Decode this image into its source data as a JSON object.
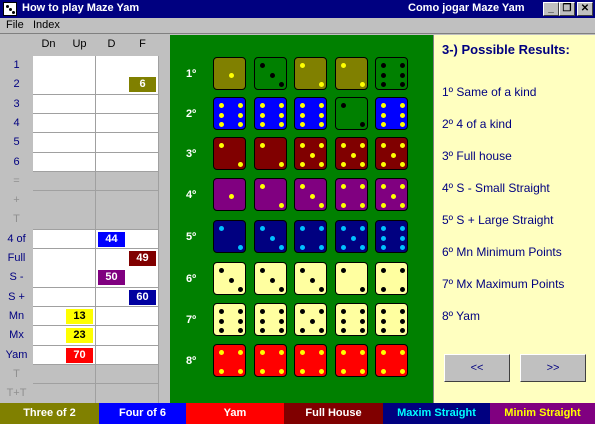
{
  "window": {
    "title_left": "How to play Maze Yam",
    "title_right": "Como jogar Maze Yam",
    "btn_minimize": "_",
    "btn_restore": "❐",
    "btn_close": "✕"
  },
  "menu": [
    "File",
    "Index"
  ],
  "sheet": {
    "columns": [
      "Dn",
      "Up",
      "D",
      "F"
    ],
    "rows": [
      "1",
      "2",
      "3",
      "4",
      "5",
      "6",
      "=",
      "+",
      "T",
      "4 of",
      "Full",
      "S -",
      "S +",
      "Mn",
      "Mx",
      "Yam",
      "T",
      "T+T"
    ],
    "values": [
      {
        "row": "2",
        "col": "F",
        "value": "6",
        "color": "#808000",
        "text": "#ffffff"
      },
      {
        "row": "4 of",
        "col": "D",
        "value": "44",
        "color": "#0000ff",
        "text": "#ffffff"
      },
      {
        "row": "Full",
        "col": "F",
        "value": "49",
        "color": "#800000",
        "text": "#ffffff"
      },
      {
        "row": "S -",
        "col": "D",
        "value": "50",
        "color": "#800080",
        "text": "#ffffff"
      },
      {
        "row": "S +",
        "col": "F",
        "value": "60",
        "color": "#0000a0",
        "text": "#ffffff"
      },
      {
        "row": "Mn",
        "col": "Up",
        "value": "13",
        "color": "#ffff00",
        "text": "#000000"
      },
      {
        "row": "Mx",
        "col": "Up",
        "value": "23",
        "color": "#ffff00",
        "text": "#000000"
      },
      {
        "row": "Yam",
        "col": "Up",
        "value": "70",
        "color": "#ff0000",
        "text": "#ffffff"
      }
    ]
  },
  "board": {
    "rows": [
      {
        "label": "1º",
        "color": "#808000",
        "pip": "#ffff00",
        "dice": [
          1,
          3,
          2,
          2,
          6
        ],
        "alt": [
          null,
          "#008000",
          null,
          null,
          "#008000"
        ],
        "altpip": [
          null,
          "#000000",
          null,
          null,
          "#000000"
        ]
      },
      {
        "label": "2º",
        "color": "#0000ff",
        "pip": "#ffff00",
        "dice": [
          6,
          6,
          6,
          2,
          6
        ],
        "alt": [
          null,
          null,
          null,
          "#008000",
          null
        ],
        "altpip": [
          null,
          null,
          null,
          "#000000",
          null
        ]
      },
      {
        "label": "3º",
        "color": "#800000",
        "pip": "#ffff00",
        "dice": [
          2,
          2,
          5,
          5,
          5
        ]
      },
      {
        "label": "4º",
        "color": "#800080",
        "pip": "#ffff00",
        "dice": [
          1,
          2,
          3,
          4,
          5
        ]
      },
      {
        "label": "5º",
        "color": "#000080",
        "pip": "#00c0ff",
        "dice": [
          2,
          3,
          4,
          5,
          6
        ]
      },
      {
        "label": "6º",
        "color": "#ffffa0",
        "pip": "#000000",
        "dice": [
          3,
          3,
          3,
          2,
          4
        ]
      },
      {
        "label": "7º",
        "color": "#ffffa0",
        "pip": "#000000",
        "dice": [
          6,
          6,
          5,
          6,
          6
        ]
      },
      {
        "label": "8º",
        "color": "#ff0000",
        "pip": "#ffff00",
        "dice": [
          4,
          4,
          4,
          4,
          4
        ]
      }
    ]
  },
  "results": {
    "title": "3-) Possible Results:",
    "items": [
      "1º  Same of a kind",
      "2º  4 of a kind",
      "3º  Full house",
      "4º  S -  Small Straight",
      "5º  S +  Large Straight",
      "6º  Mn  Minimum Points",
      "7º  Mx  Maximum Points",
      "8º  Yam"
    ],
    "prev_label": "<<",
    "next_label": ">>"
  },
  "legend": [
    {
      "label": "Three of  2",
      "bg": "#808000",
      "fg": "#ffffff"
    },
    {
      "label": "Four of  6",
      "bg": "#0000ff",
      "fg": "#ffffff"
    },
    {
      "label": "Yam",
      "bg": "#ff0000",
      "fg": "#ffffff"
    },
    {
      "label": "Full House",
      "bg": "#800000",
      "fg": "#ffffff"
    },
    {
      "label": "Maxim Straight",
      "bg": "#000080",
      "fg": "#00ffff"
    },
    {
      "label": "Minim Straight",
      "bg": "#800080",
      "fg": "#ffff00"
    }
  ]
}
